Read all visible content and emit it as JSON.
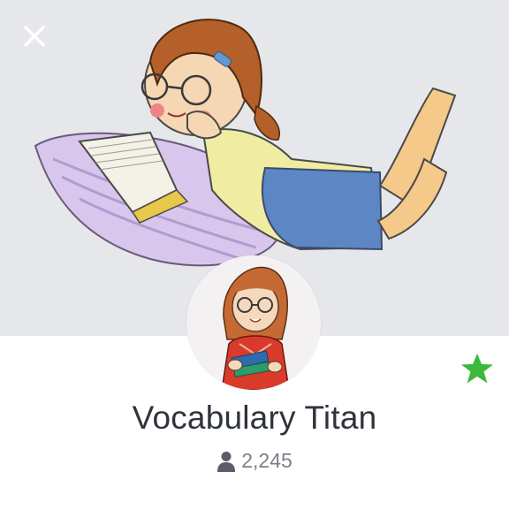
{
  "profile": {
    "name": "Vocabulary Titan",
    "member_count": "2,245",
    "favorited": true
  },
  "icons": {
    "close": "close-icon",
    "favorite": "star-icon",
    "members": "person-icon"
  },
  "colors": {
    "star": "#3cb83c",
    "cover_background": "#e6e7ea",
    "name_text": "#2f343c",
    "count_text": "#7c8089"
  }
}
